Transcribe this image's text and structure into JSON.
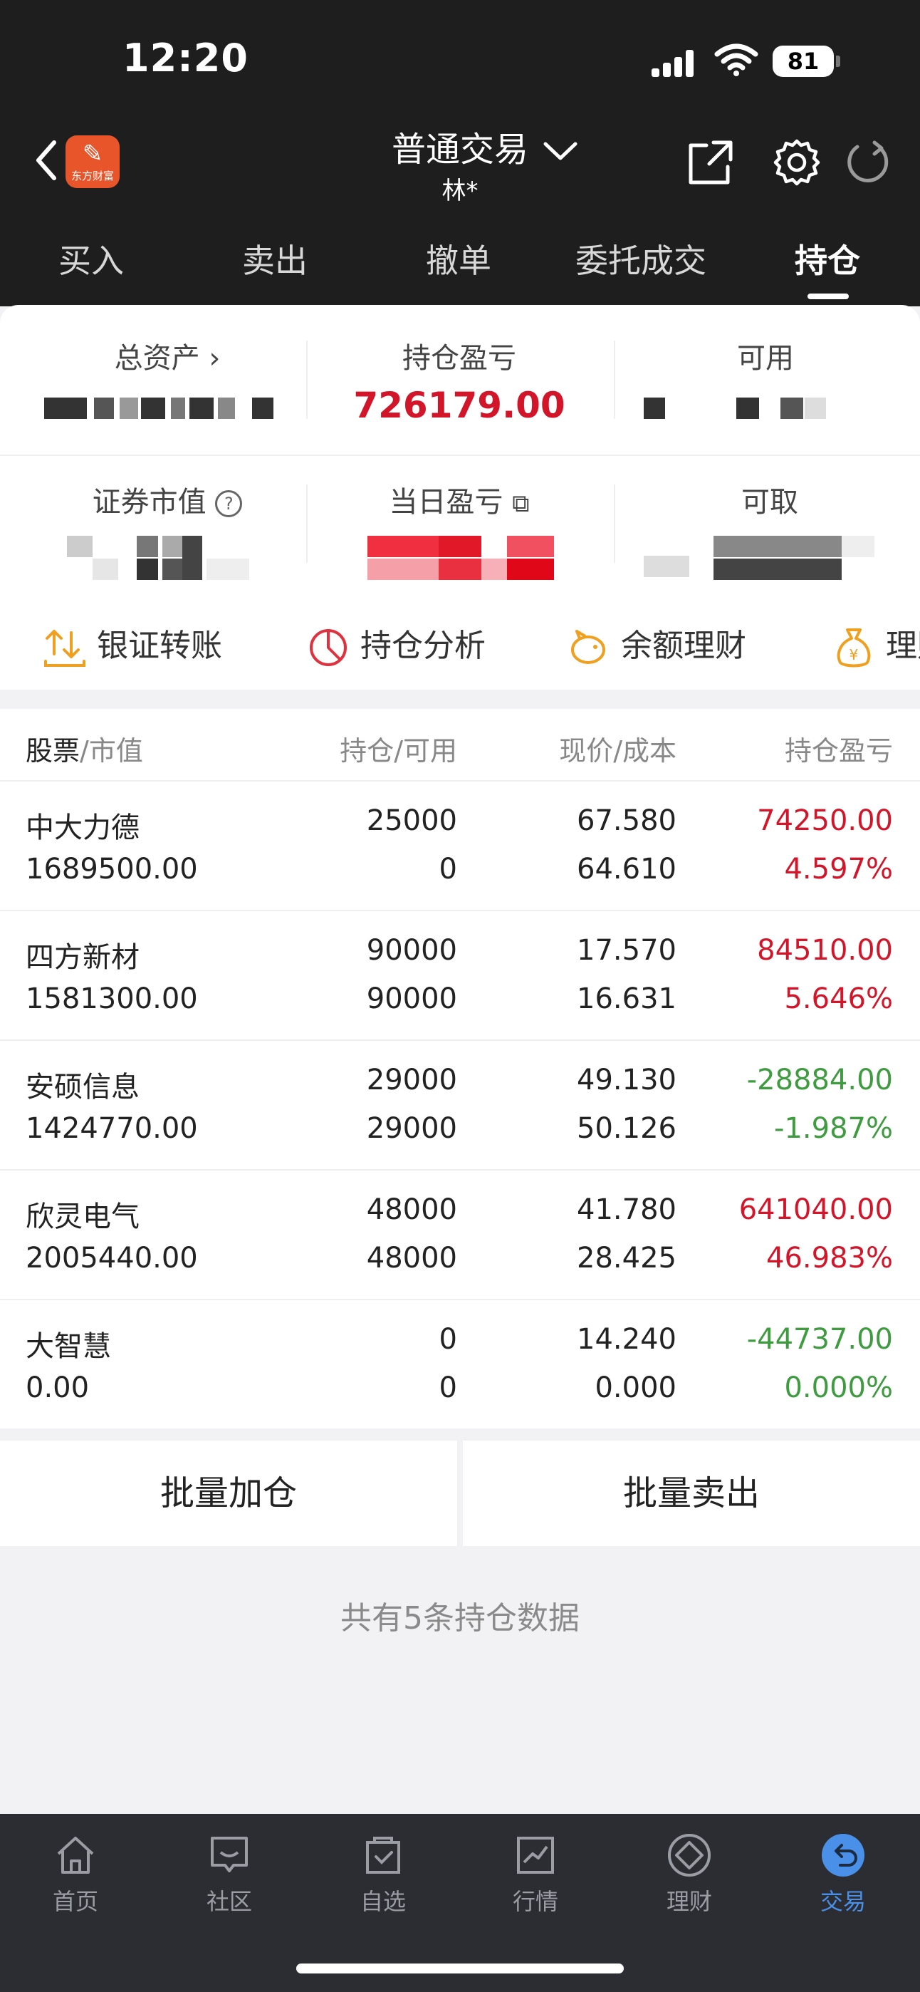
{
  "status": {
    "time": "12:20",
    "battery": "81"
  },
  "header": {
    "logo_text": "东方财富",
    "title": "普通交易",
    "account": "林*"
  },
  "tabs": [
    {
      "label": "买入"
    },
    {
      "label": "卖出"
    },
    {
      "label": "撤单"
    },
    {
      "label": "委托成交"
    },
    {
      "label": "持仓",
      "active": true
    }
  ],
  "summary": {
    "total_assets_label": "总资产",
    "position_pnl_label": "持仓盈亏",
    "position_pnl_value": "726179.00",
    "available_label": "可用",
    "market_value_label": "证券市值",
    "daily_pnl_label": "当日盈亏",
    "withdrawable_label": "可取"
  },
  "quick_actions": [
    {
      "label": "银证转账",
      "icon": "transfer-icon"
    },
    {
      "label": "持仓分析",
      "icon": "pie-chart-icon"
    },
    {
      "label": "余额理财",
      "icon": "piggy-bank-icon"
    },
    {
      "label": "理财",
      "icon": "money-bag-icon"
    }
  ],
  "table": {
    "headers": {
      "stock": "股票",
      "market_value": "/市值",
      "position": "持仓/可用",
      "price": "现价/成本",
      "pnl": "持仓盈亏"
    },
    "rows": [
      {
        "name": "中大力德",
        "value": "1689500.00",
        "hold": "25000",
        "avail": "0",
        "price": "67.580",
        "cost": "64.610",
        "pnl": "74250.00",
        "pct": "4.597%",
        "dir": "up"
      },
      {
        "name": "四方新材",
        "value": "1581300.00",
        "hold": "90000",
        "avail": "90000",
        "price": "17.570",
        "cost": "16.631",
        "pnl": "84510.00",
        "pct": "5.646%",
        "dir": "up"
      },
      {
        "name": "安硕信息",
        "value": "1424770.00",
        "hold": "29000",
        "avail": "29000",
        "price": "49.130",
        "cost": "50.126",
        "pnl": "-28884.00",
        "pct": "-1.987%",
        "dir": "down"
      },
      {
        "name": "欣灵电气",
        "value": "2005440.00",
        "hold": "48000",
        "avail": "48000",
        "price": "41.780",
        "cost": "28.425",
        "pnl": "641040.00",
        "pct": "46.983%",
        "dir": "up"
      },
      {
        "name": "大智慧",
        "value": "0.00",
        "hold": "0",
        "avail": "0",
        "price": "14.240",
        "cost": "0.000",
        "pnl": "-44737.00",
        "pct": "0.000%",
        "dir": "down"
      }
    ]
  },
  "actions": {
    "batch_add": "批量加仓",
    "batch_sell": "批量卖出"
  },
  "footer_count": "共有5条持仓数据",
  "bottom_nav": [
    {
      "label": "首页",
      "icon": "home-icon"
    },
    {
      "label": "社区",
      "icon": "chat-icon"
    },
    {
      "label": "自选",
      "icon": "bag-check-icon"
    },
    {
      "label": "行情",
      "icon": "trend-chart-icon"
    },
    {
      "label": "理财",
      "icon": "diamond-icon"
    },
    {
      "label": "交易",
      "icon": "trade-return-icon",
      "active": true
    }
  ],
  "colors": {
    "up": "#d3152a",
    "down": "#3f9b3f",
    "accent": "#4a8fe8",
    "header_bg": "#1e1e1e"
  }
}
